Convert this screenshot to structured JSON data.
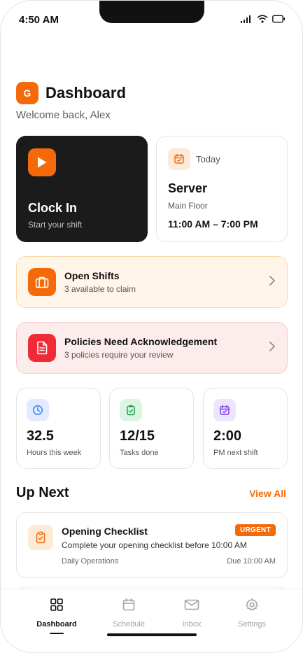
{
  "status_bar": {
    "time": "4:50 AM"
  },
  "header": {
    "avatar_initial": "G",
    "title": "Dashboard",
    "welcome": "Welcome back, Alex"
  },
  "clock_in": {
    "title": "Clock In",
    "subtitle": "Start your shift"
  },
  "shift": {
    "label": "Today",
    "role": "Server",
    "location": "Main Floor",
    "time": "11:00 AM – 7:00 PM"
  },
  "alerts": [
    {
      "title": "Open Shifts",
      "subtitle": "3 available to claim"
    },
    {
      "title": "Policies Need Acknowledgement",
      "subtitle": "3 policies require your review"
    }
  ],
  "stats": [
    {
      "value": "32.5",
      "label": "Hours this week",
      "icon": "clock-icon",
      "color": "#3b82f6"
    },
    {
      "value": "12/15",
      "label": "Tasks done",
      "icon": "clipboard-check-icon",
      "color": "#16a34a"
    },
    {
      "value": "2:00",
      "label": "PM next shift",
      "icon": "calendar-check-icon",
      "color": "#7c3aed"
    }
  ],
  "up_next": {
    "title": "Up Next",
    "view_all": "View All",
    "tasks": [
      {
        "title": "Opening Checklist",
        "badge": "URGENT",
        "description": "Complete your opening checklist before 10:00 AM",
        "category": "Daily Operations",
        "due": "Due 10:00 AM"
      }
    ]
  },
  "nav": {
    "items": [
      {
        "label": "Dashboard",
        "icon": "grid-icon",
        "active": true
      },
      {
        "label": "Schedule",
        "icon": "calendar-icon",
        "active": false
      },
      {
        "label": "Inbox",
        "icon": "mail-icon",
        "active": false
      },
      {
        "label": "Settings",
        "icon": "gear-icon",
        "active": false
      }
    ]
  },
  "colors": {
    "accent": "#f46a0b",
    "danger": "#ef2b35",
    "dark_card": "#1b1b1b"
  }
}
